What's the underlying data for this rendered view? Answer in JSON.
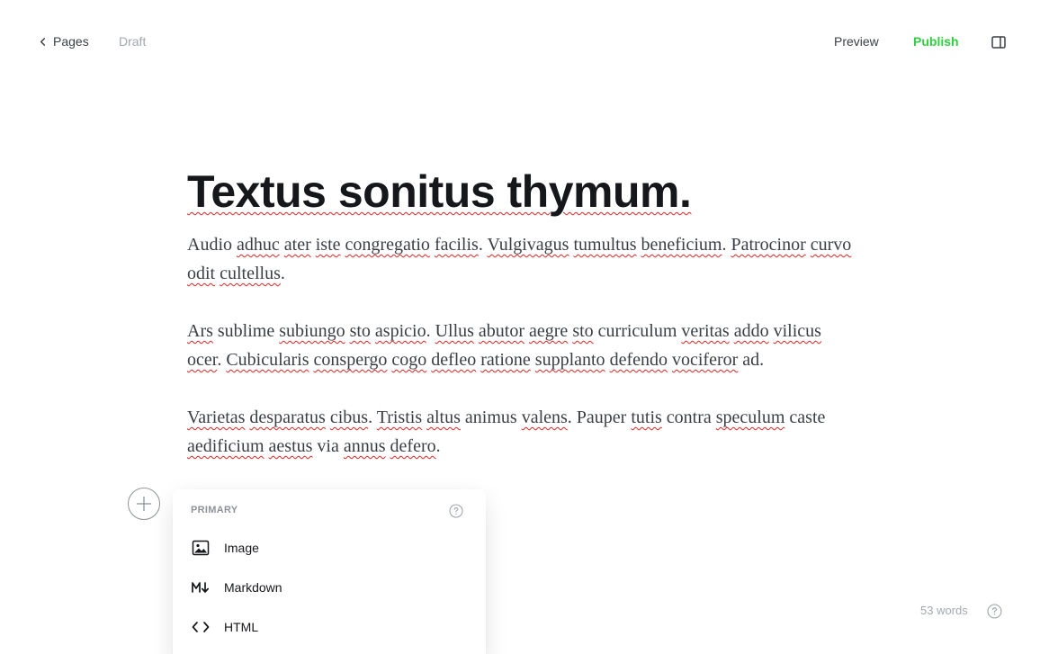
{
  "topbar": {
    "back_label": "Pages",
    "status": "Draft",
    "preview_label": "Preview",
    "publish_label": "Publish",
    "publish_color": "#30cf43"
  },
  "editor": {
    "title": "Textus sonitus thymum.",
    "paragraphs": [
      "Audio adhuc ater iste congregatio facilis. Vulgivagus tumultus beneficium. Patrocinor curvo odit cultellus.",
      "Ars sublime subiungo sto aspicio. Ullus abutor aegre sto curriculum veritas addo vilicus ocer. Cubicularis conspergo cogo defleo ratione supplanto defendo vociferor ad.",
      "Varietas desparatus cibus. Tristis altus animus valens. Pauper tutis contra speculum caste aedificium aestus via annus defero."
    ],
    "spellcheck_color": "#e02424"
  },
  "card_menu": {
    "section": "PRIMARY",
    "items": [
      {
        "label": "Image",
        "icon": "image-icon"
      },
      {
        "label": "Markdown",
        "icon": "markdown-icon"
      },
      {
        "label": "HTML",
        "icon": "code-icon"
      }
    ]
  },
  "footer": {
    "word_count": "53 words"
  }
}
